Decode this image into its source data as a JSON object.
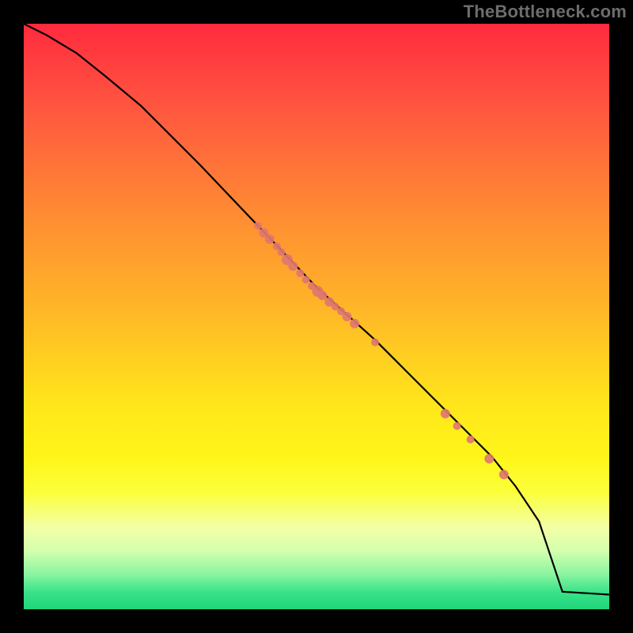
{
  "watermark": {
    "text": "TheBottleneck.com"
  },
  "chart_data": {
    "type": "line",
    "title": "",
    "xlabel": "",
    "ylabel": "",
    "xlim": [
      0,
      100
    ],
    "ylim": [
      0,
      100
    ],
    "line": {
      "x": [
        0,
        4,
        9,
        14,
        20,
        30,
        40,
        50,
        55,
        60,
        65,
        70,
        75,
        80,
        84,
        88,
        92,
        100
      ],
      "y": [
        100,
        98,
        95,
        91,
        86,
        76,
        65.5,
        55,
        50.5,
        46,
        41,
        36,
        31,
        26,
        21,
        15,
        3,
        2.5
      ]
    },
    "points": [
      {
        "x": 40.0,
        "y": 65.5,
        "r": 5
      },
      {
        "x": 41.0,
        "y": 64.3,
        "r": 6
      },
      {
        "x": 42.0,
        "y": 63.2,
        "r": 6
      },
      {
        "x": 43.2,
        "y": 62.0,
        "r": 5
      },
      {
        "x": 44.0,
        "y": 61.0,
        "r": 5
      },
      {
        "x": 45.0,
        "y": 59.7,
        "r": 7
      },
      {
        "x": 46.0,
        "y": 58.6,
        "r": 6
      },
      {
        "x": 47.2,
        "y": 57.4,
        "r": 5
      },
      {
        "x": 48.2,
        "y": 56.3,
        "r": 5
      },
      {
        "x": 49.2,
        "y": 55.2,
        "r": 5
      },
      {
        "x": 50.2,
        "y": 54.3,
        "r": 7
      },
      {
        "x": 51.0,
        "y": 53.6,
        "r": 6
      },
      {
        "x": 52.2,
        "y": 52.5,
        "r": 6
      },
      {
        "x": 53.2,
        "y": 51.7,
        "r": 5
      },
      {
        "x": 54.2,
        "y": 50.9,
        "r": 5
      },
      {
        "x": 55.2,
        "y": 50.0,
        "r": 6
      },
      {
        "x": 56.5,
        "y": 48.8,
        "r": 6
      },
      {
        "x": 60.0,
        "y": 45.6,
        "r": 5
      },
      {
        "x": 72.0,
        "y": 33.4,
        "r": 6
      },
      {
        "x": 74.0,
        "y": 31.3,
        "r": 5
      },
      {
        "x": 76.3,
        "y": 29.0,
        "r": 5
      },
      {
        "x": 79.5,
        "y": 25.7,
        "r": 6
      },
      {
        "x": 82.0,
        "y": 23.0,
        "r": 6
      }
    ],
    "point_color_approx": "#e0776f",
    "gradient_stops": [
      {
        "pos": 0.0,
        "color": "#ff2a3d"
      },
      {
        "pos": 0.5,
        "color": "#ffd220"
      },
      {
        "pos": 0.85,
        "color": "#f4ffa6"
      },
      {
        "pos": 1.0,
        "color": "#1fd47a"
      }
    ]
  }
}
